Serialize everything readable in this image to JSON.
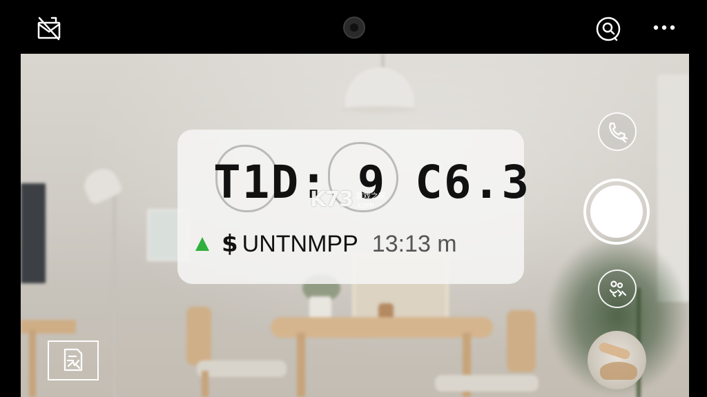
{
  "top_bar": {
    "left_icon": "mail-off-icon",
    "camera": "front-camera-icon",
    "search_icon": "search-scan-icon",
    "more_icon": "more-options-icon"
  },
  "ocr_overlay": {
    "main_text": "T1D: 9 C6.3",
    "watermark_logo": "K73",
    "watermark_line1": "游戏之家",
    "watermark_line2": ".com",
    "trend_icon": "up-triangle-icon",
    "trend_color": "#2fb03d",
    "currency_symbol": "$",
    "label": "UNTNMPP",
    "time": "13:13 m"
  },
  "controls": {
    "call_icon": "phone-call-icon",
    "shutter": "shutter-button",
    "effects_icon": "effects-icon",
    "thumbnail": "last-photo-thumbnail",
    "gallery_icon": "gallery-edit-icon"
  }
}
